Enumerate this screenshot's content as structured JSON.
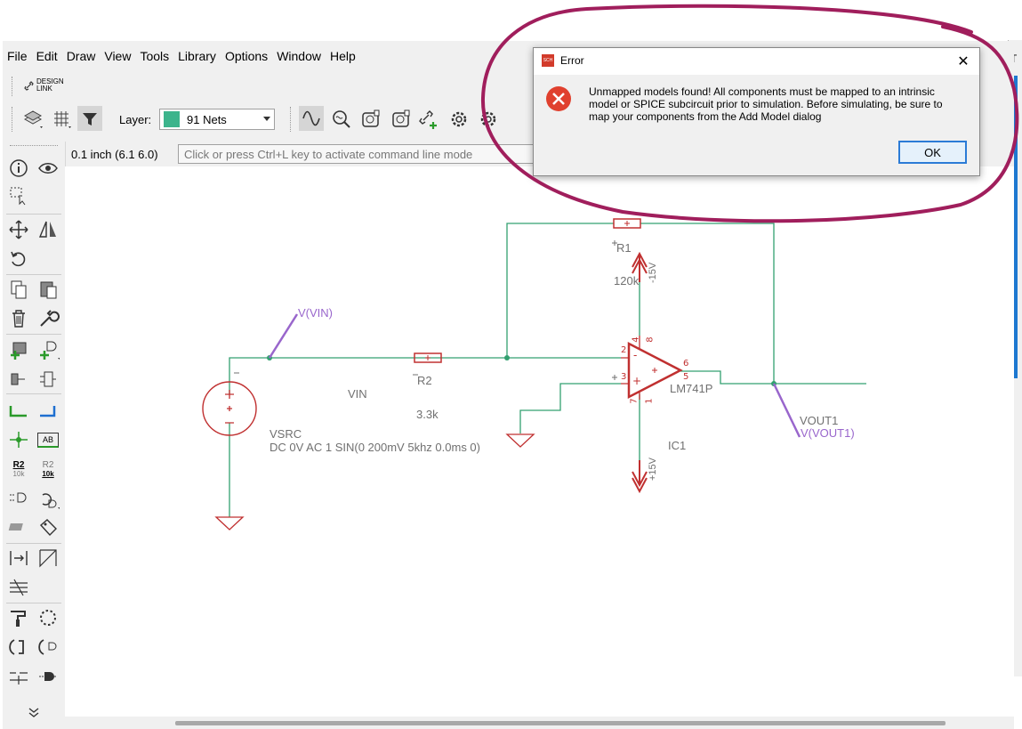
{
  "menu": [
    "File",
    "Edit",
    "Draw",
    "View",
    "Tools",
    "Library",
    "Options",
    "Window",
    "Help"
  ],
  "design_link": {
    "line1": "DESIGN",
    "line2": "LINK"
  },
  "toolbar": {
    "layer_label": "Layer:",
    "layer_value": "91 Nets",
    "layer_color": "#3cb48c"
  },
  "status": {
    "grid_readout": "0.1 inch (6.1 6.0)",
    "command_placeholder": "Click or press Ctrl+L key to activate command line mode"
  },
  "dialog": {
    "title": "Error",
    "message": "Unmapped models found! All components must be mapped to an intrinsic model or SPICE subcircuit prior to simulation.  Before simulating, be sure to map your components from the Add Model dialog",
    "ok_label": "OK",
    "app_icon_text": "SCH"
  },
  "schematic": {
    "r1_name": "R1",
    "r1_value": "120k",
    "r2_name": "R2",
    "r2_value": "3.3k",
    "vsrc_name": "VSRC",
    "vsrc_value": "DC 0V AC 1 SIN(0 200mV 5khz 0.0ms 0)",
    "opamp_name": "LM741P",
    "opamp_ref": "IC1",
    "vin_net": "VIN",
    "vin_probe": "V(VIN)",
    "vout_net": "VOUT1",
    "vout_probe": "V(VOUT1)",
    "supply_top": "-15V",
    "supply_bottom": "+15V",
    "pin2": "2",
    "pin3": "3",
    "pin4": "4",
    "pin8": "8",
    "pin6": "6",
    "pin5": "5",
    "pin7": "7",
    "pin1": "1",
    "pin_minus": "-",
    "pin_plus": "+"
  },
  "tools_labels": {
    "r2_a": "R2",
    "r2_a_val": "10k",
    "r2_b": "R2",
    "r2_b_val": "10k",
    "ab": "AB"
  },
  "right_panel_letter": "T",
  "colors": {
    "wire": "#33a070",
    "component": "#c03030",
    "probe": "#9966cc",
    "annotation": "#a01e5c",
    "text_gray": "#707070"
  }
}
